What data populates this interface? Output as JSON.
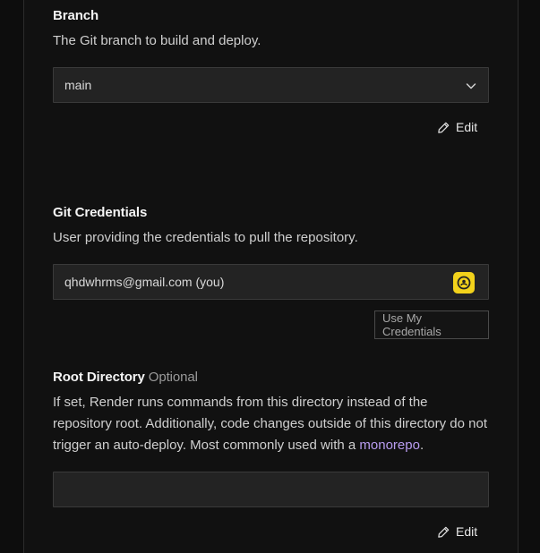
{
  "branch": {
    "label": "Branch",
    "description": "The Git branch to build and deploy.",
    "selected": "main",
    "edit_label": "Edit"
  },
  "git_credentials": {
    "label": "Git Credentials",
    "description": "User providing the credentials to pull the repository.",
    "value": "qhdwhrms@gmail.com (you)",
    "use_my_credentials_label": "Use My Credentials",
    "avatar_color": "#f2d21b"
  },
  "root_directory": {
    "label": "Root Directory",
    "optional_label": "Optional",
    "description_before_link": "If set, Render runs commands from this directory instead of the repository root. Additionally, code changes outside of this directory do not trigger an auto-deploy. Most commonly used with a ",
    "link_text": "monorepo",
    "description_after_link": ".",
    "value": "",
    "edit_label": "Edit"
  },
  "colors": {
    "background": "#111111",
    "field": "#232323",
    "link": "#b89cf0"
  }
}
